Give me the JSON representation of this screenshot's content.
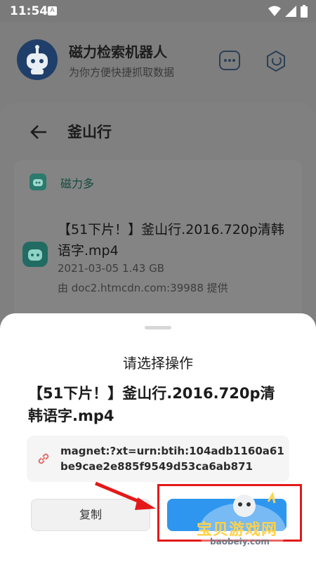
{
  "status_bar": {
    "time": "11:54",
    "notification_glyph": "A",
    "icons": [
      "wifi-icon",
      "signal-icon",
      "battery-icon"
    ]
  },
  "app": {
    "title": "磁力检索机器人",
    "subtitle": "为你方便快捷抓取数据"
  },
  "page": {
    "title": "釜山行"
  },
  "result": {
    "source_name": "磁力多",
    "file_name": "【51下片！】釜山行.2016.720p清韩语字.mp4",
    "meta": "2021-03-05  1.43 GB",
    "source_line": "由 doc2.htmcdn.com:39988 提供"
  },
  "action_sheet": {
    "title": "请选择操作",
    "file_name": "【51下片！】釜山行.2016.720p清韩语字.mp4",
    "magnet": "magnet:?xt=urn:btih:104adb1160a61be9cae2e885f9549d53ca6ab871",
    "copy_label": "复制"
  },
  "watermark": {
    "text": "宝贝游戏网",
    "url": "baobeiy.com"
  },
  "colors": {
    "accent": "#2e96ef",
    "highlight": "#e31919",
    "overlay": "#7e7e7e"
  }
}
